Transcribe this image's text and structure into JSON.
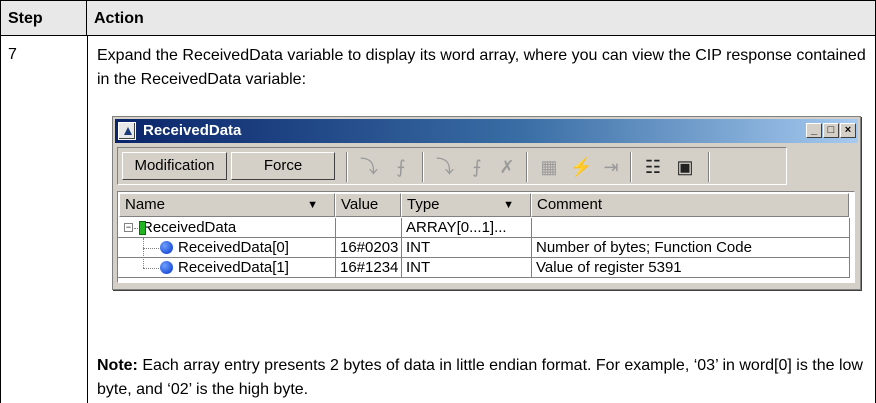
{
  "table": {
    "header_step": "Step",
    "header_action": "Action",
    "step_number": "7",
    "action_text": "Expand the ReceivedData variable to display its word array, where you can view the CIP response contained in the ReceivedData variable:",
    "note_label": "Note:",
    "note_text": " Each array entry presents 2 bytes of data in little endian format. For example, ‘03’ in word[0] is the low byte, and ‘02’ is the high byte."
  },
  "window": {
    "title": "ReceivedData",
    "controls": [
      "_",
      "□",
      "×"
    ],
    "toolbar": {
      "modification_label": "Modification",
      "force_label": "Force"
    },
    "columns": [
      "Name",
      "Value",
      "Type",
      "Comment"
    ],
    "rows": [
      {
        "name": "ReceivedData",
        "value": "",
        "type": "ARRAY[0...1]...",
        "comment": ""
      },
      {
        "name": "ReceivedData[0]",
        "value": "16#0203",
        "type": "INT",
        "comment": "Number of bytes; Function Code"
      },
      {
        "name": "ReceivedData[1]",
        "value": "16#1234",
        "type": "INT",
        "comment": "Value of register 5391"
      }
    ]
  }
}
